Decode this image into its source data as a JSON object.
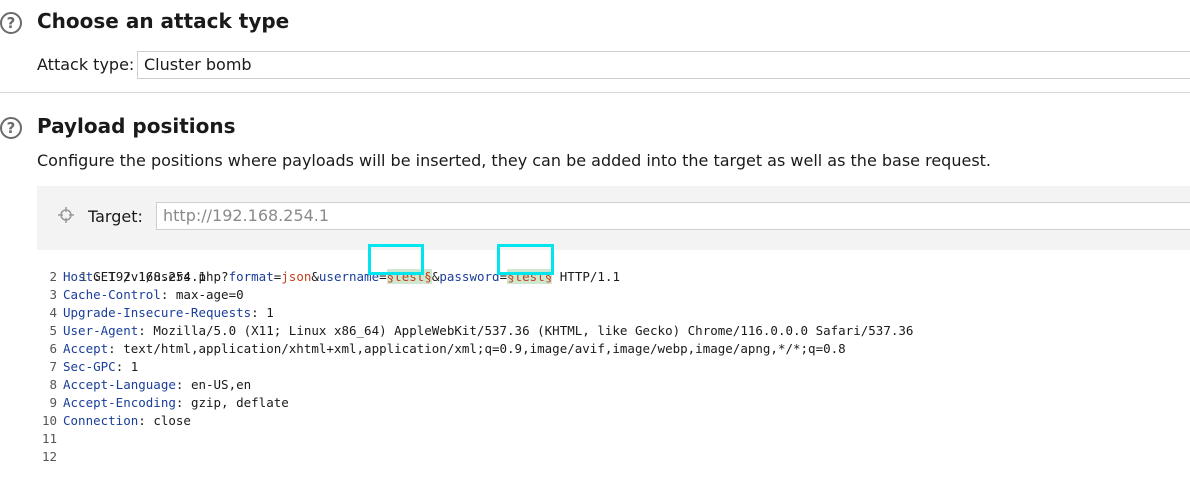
{
  "attack_section": {
    "title": "Choose an attack type",
    "field_label": "Attack type:",
    "field_value": "Cluster bomb"
  },
  "payload_section": {
    "title": "Payload positions",
    "description": "Configure the positions where payloads will be inserted, they can be added into the target as well as the base request.",
    "target_label": "Target:",
    "target_value": "http://192.168.254.1"
  },
  "request": {
    "line1": {
      "num": "1",
      "method": "GET /v1/users.php?",
      "p1_key": "format",
      "p1_eq": "=",
      "p1_val": "json",
      "amp1": "&",
      "p2_key": "username",
      "p2_eq": "=",
      "p2_marker": "§test§",
      "amp2": "&",
      "p3_key": "password",
      "p3_eq": "=",
      "p3_marker": "§test§",
      "proto": " HTTP/1.1"
    },
    "headers": [
      {
        "num": "2",
        "key": "Host",
        "sep": ": ",
        "val": "192.168.254.1"
      },
      {
        "num": "3",
        "key": "Cache-Control",
        "sep": ": ",
        "val": "max-age=0"
      },
      {
        "num": "4",
        "key": "Upgrade-Insecure-Requests",
        "sep": ": ",
        "val": "1"
      },
      {
        "num": "5",
        "key": "User-Agent",
        "sep": ": ",
        "val": "Mozilla/5.0 (X11; Linux x86_64) AppleWebKit/537.36 (KHTML, like Gecko) Chrome/116.0.0.0 Safari/537.36"
      },
      {
        "num": "6",
        "key": "Accept",
        "sep": ": ",
        "val": "text/html,application/xhtml+xml,application/xml;q=0.9,image/avif,image/webp,image/apng,*/*;q=0.8"
      },
      {
        "num": "7",
        "key": "Sec-GPC",
        "sep": ": ",
        "val": "1"
      },
      {
        "num": "8",
        "key": "Accept-Language",
        "sep": ": ",
        "val": "en-US,en"
      },
      {
        "num": "9",
        "key": "Accept-Encoding",
        "sep": ": ",
        "val": "gzip, deflate"
      },
      {
        "num": "10",
        "key": "Connection",
        "sep": ": ",
        "val": "close"
      }
    ],
    "empty_lines": [
      "11",
      "12"
    ]
  },
  "icons": {
    "help": "question-circle-icon",
    "target": "crosshair-icon"
  },
  "colors": {
    "highlight_border": "#00e5ee",
    "param_key": "#1a3e9a",
    "param_value": "#c4401e",
    "marker_bg": "#cfe6cf"
  }
}
